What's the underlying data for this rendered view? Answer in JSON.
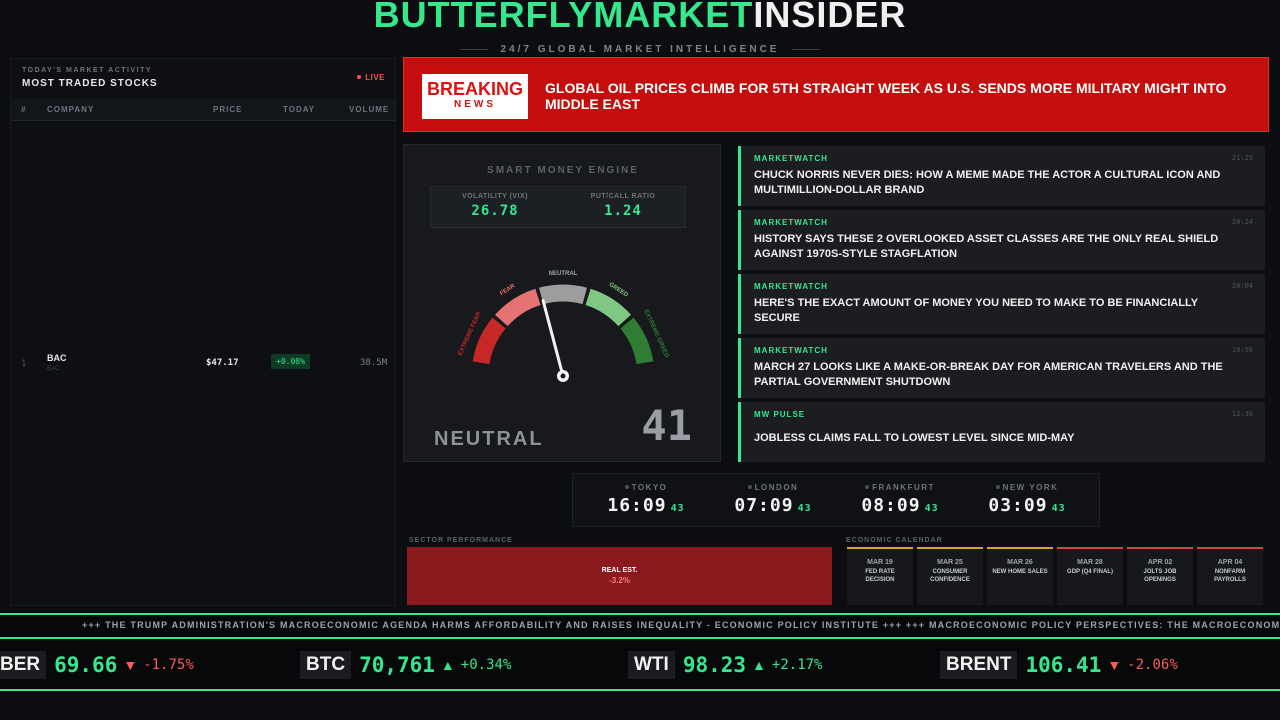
{
  "header": {
    "brand_part1": "BUTTERFLYMARKET",
    "brand_part2": "INSIDER",
    "tagline": "24/7 GLOBAL MARKET INTELLIGENCE"
  },
  "left_panel": {
    "subtitle": "TODAY'S MARKET ACTIVITY",
    "title": "MOST TRADED STOCKS",
    "live_label": "LIVE",
    "columns": [
      "#",
      "COMPANY",
      "PRICE",
      "TODAY",
      "VOLUME"
    ],
    "rows": [
      {
        "rank": "1",
        "ticker": "BAC",
        "sub": "BAC",
        "price": "$47.17",
        "change": "+0.08%",
        "volume": "38.5M"
      }
    ]
  },
  "breaking": {
    "badge_top": "BREAKING",
    "badge_bottom": "NEWS",
    "headline": "GLOBAL OIL PRICES CLIMB FOR 5TH STRAIGHT WEEK AS U.S. SENDS MORE MILITARY MIGHT INTO MIDDLE EAST"
  },
  "gauge": {
    "title": "SMART MONEY ENGINE",
    "vix_label": "VOLATILITY (VIX)",
    "vix_value": "26.78",
    "pcr_label": "PUT/CALL RATIO",
    "pcr_value": "1.24",
    "zones": [
      "EXTREME FEAR",
      "FEAR",
      "NEUTRAL",
      "GREED",
      "EXTREME GREED"
    ],
    "zone_colors": [
      "#c62828",
      "#e57373",
      "#9e9e9e",
      "#81c784",
      "#2e7d32"
    ],
    "reading_label": "NEUTRAL",
    "reading_value": "41",
    "score": 41
  },
  "news": [
    {
      "source": "MARKETWATCH",
      "time": "21:29",
      "headline": "CHUCK NORRIS NEVER DIES: HOW A MEME MADE THE ACTOR A CULTURAL ICON AND MULTIMILLION-DOLLAR BRAND"
    },
    {
      "source": "MARKETWATCH",
      "time": "20:24",
      "headline": "HISTORY SAYS THESE 2 OVERLOOKED ASSET CLASSES ARE THE ONLY REAL SHIELD AGAINST 1970S-STYLE STAGFLATION"
    },
    {
      "source": "MARKETWATCH",
      "time": "20:04",
      "headline": "HERE'S THE EXACT AMOUNT OF MONEY YOU NEED TO MAKE TO BE FINANCIALLY SECURE"
    },
    {
      "source": "MARKETWATCH",
      "time": "19:56",
      "headline": "MARCH 27 LOOKS LIKE A MAKE-OR-BREAK DAY FOR AMERICAN TRAVELERS AND THE PARTIAL GOVERNMENT SHUTDOWN"
    },
    {
      "source": "MW PULSE",
      "time": "12:36",
      "headline": "JOBLESS CLAIMS FALL TO LOWEST LEVEL SINCE MID-MAY"
    }
  ],
  "clocks": [
    {
      "city": "TOKYO",
      "time": "16:09",
      "sec": "43"
    },
    {
      "city": "LONDON",
      "time": "07:09",
      "sec": "43"
    },
    {
      "city": "FRANKFURT",
      "time": "08:09",
      "sec": "43"
    },
    {
      "city": "NEW YORK",
      "time": "03:09",
      "sec": "43"
    }
  ],
  "sector": {
    "label": "SECTOR PERFORMANCE",
    "name": "REAL EST.",
    "change": "-3.2%"
  },
  "calendar": {
    "label": "ECONOMIC CALENDAR",
    "events": [
      {
        "date": "MAR 19",
        "event": "FED RATE DECISION"
      },
      {
        "date": "MAR 25",
        "event": "CONSUMER CONFIDENCE"
      },
      {
        "date": "MAR 26",
        "event": "NEW HOME SALES"
      },
      {
        "date": "MAR 28",
        "event": "GDP (Q4 FINAL)"
      },
      {
        "date": "APR 02",
        "event": "JOLTS JOB OPENINGS"
      },
      {
        "date": "APR 04",
        "event": "NONFARM PAYROLLS"
      }
    ]
  },
  "ticker": {
    "headline_scroll": "+++ THE TRUMP ADMINISTRATION'S MACROECONOMIC AGENDA HARMS AFFORDABILITY AND RAISES INEQUALITY - ECONOMIC POLICY INSTITUTE +++ +++ MACROECONOMIC POLICY PERSPECTIVES: THE MACROECONOMIC",
    "items": [
      {
        "symbol": "BER",
        "price": "69.66",
        "arrow": "▼",
        "change": "-1.75%",
        "dir": "dn"
      },
      {
        "symbol": "BTC",
        "price": "70,761",
        "arrow": "▲",
        "change": "+0.34%",
        "dir": "up"
      },
      {
        "symbol": "WTI",
        "price": "98.23",
        "arrow": "▲",
        "change": "+2.17%",
        "dir": "up"
      },
      {
        "symbol": "BRENT",
        "price": "106.41",
        "arrow": "▼",
        "change": "-2.06%",
        "dir": "dn"
      }
    ]
  }
}
